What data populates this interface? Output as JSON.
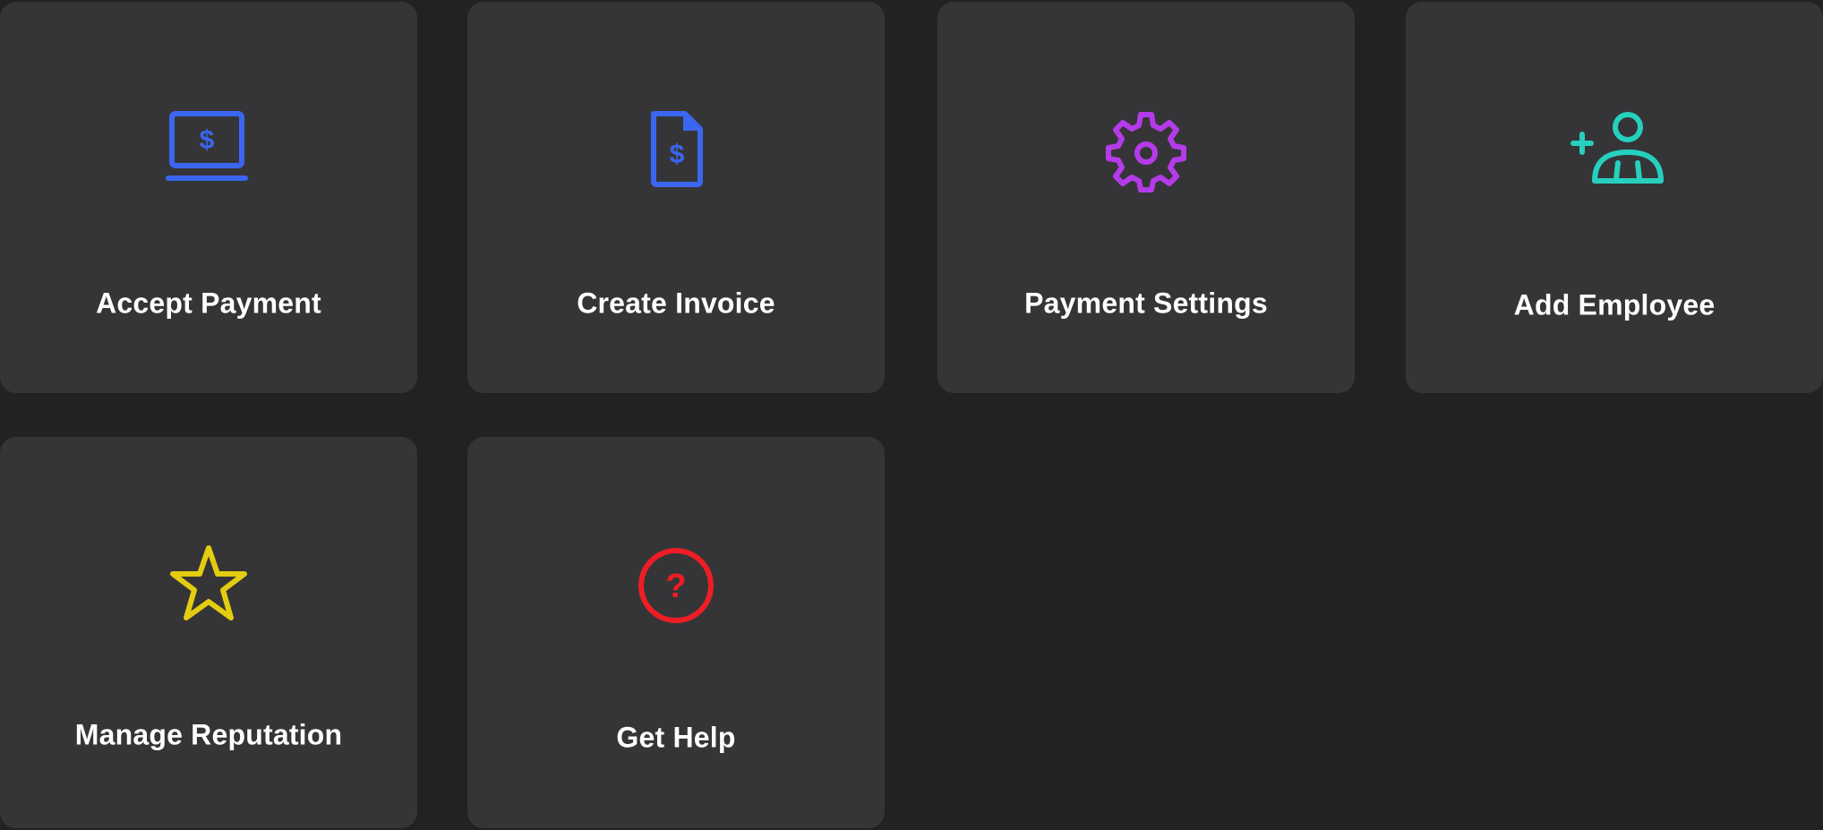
{
  "tiles": [
    {
      "label": "Accept Payment",
      "icon": "laptop-dollar-icon",
      "color": "#3A66F0"
    },
    {
      "label": "Create Invoice",
      "icon": "document-dollar-icon",
      "color": "#3A66F0"
    },
    {
      "label": "Payment Settings",
      "icon": "gear-icon",
      "color": "#B53BEA"
    },
    {
      "label": "Add Employee",
      "icon": "add-user-icon",
      "color": "#26D0BE"
    },
    {
      "label": "Manage Reputation",
      "icon": "star-icon",
      "color": "#E4CC10"
    },
    {
      "label": "Get Help",
      "icon": "question-circle-icon",
      "color": "#EE1E24"
    }
  ]
}
